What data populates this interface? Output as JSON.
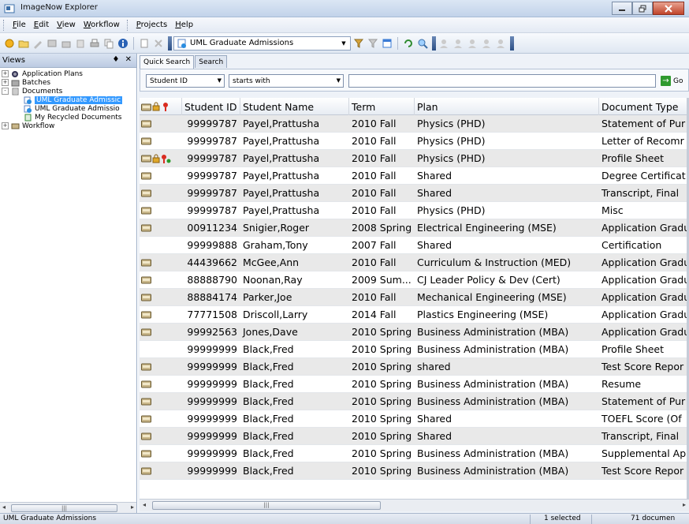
{
  "window": {
    "title": "ImageNow Explorer"
  },
  "menu": [
    {
      "label": "File",
      "u": "F",
      "rest": "ile"
    },
    {
      "label": "Edit",
      "u": "E",
      "rest": "dit"
    },
    {
      "label": "View",
      "u": "V",
      "rest": "iew"
    },
    {
      "label": "Workflow",
      "u": "W",
      "rest": "orkflow"
    },
    {
      "label": "Projects",
      "u": "P",
      "rest": "rojects"
    },
    {
      "label": "Help",
      "u": "H",
      "rest": "elp"
    }
  ],
  "toolbar": {
    "view_dropdown": "UML Graduate Admissions"
  },
  "views_panel": {
    "title": "Views",
    "tree": [
      {
        "label": "Application Plans",
        "expander": "+",
        "icon": "application-plans-icon",
        "indent": 0
      },
      {
        "label": "Batches",
        "expander": "+",
        "icon": "batches-icon",
        "indent": 0
      },
      {
        "label": "Documents",
        "expander": "-",
        "icon": "documents-icon",
        "indent": 0
      },
      {
        "label": "UML Graduate Admissic",
        "expander": "",
        "icon": "document-view-icon",
        "indent": 1,
        "selected": true
      },
      {
        "label": "UML Graduate Admissio",
        "expander": "",
        "icon": "document-view-icon",
        "indent": 1
      },
      {
        "label": "My Recycled Documents",
        "expander": "",
        "icon": "recycle-icon",
        "indent": 1
      },
      {
        "label": "Workflow",
        "expander": "+",
        "icon": "workflow-icon",
        "indent": 0
      }
    ]
  },
  "tabs": [
    {
      "label": "Quick Search",
      "active": true
    },
    {
      "label": "Search",
      "active": false
    }
  ],
  "search": {
    "field": "Student ID",
    "operator": "starts with",
    "value": "",
    "go_label": "Go"
  },
  "grid": {
    "columns": [
      "Student ID",
      "Student Name",
      "Term",
      "Plan",
      "Document Type"
    ],
    "rows": [
      {
        "icons": [
          "doc"
        ],
        "sid": "99999787",
        "name": "Payel,Prattusha",
        "term": "2010 Fall",
        "plan": "Physics (PHD)",
        "doc": "Statement of Pur"
      },
      {
        "icons": [
          "doc"
        ],
        "sid": "99999787",
        "name": "Payel,Prattusha",
        "term": "2010 Fall",
        "plan": "Physics (PHD)",
        "doc": "Letter of Recomr"
      },
      {
        "icons": [
          "doc",
          "lock",
          "flag"
        ],
        "sid": "99999787",
        "name": "Payel,Prattusha",
        "term": "2010 Fall",
        "plan": "Physics (PHD)",
        "doc": "Profile Sheet"
      },
      {
        "icons": [
          "doc"
        ],
        "sid": "99999787",
        "name": "Payel,Prattusha",
        "term": "2010 Fall",
        "plan": "Shared",
        "doc": "Degree Certificat"
      },
      {
        "icons": [
          "doc"
        ],
        "sid": "99999787",
        "name": "Payel,Prattusha",
        "term": "2010 Fall",
        "plan": "Shared",
        "doc": "Transcript, Final"
      },
      {
        "icons": [
          "doc"
        ],
        "sid": "99999787",
        "name": "Payel,Prattusha",
        "term": "2010 Fall",
        "plan": "Physics (PHD)",
        "doc": "Misc"
      },
      {
        "icons": [
          "doc"
        ],
        "sid": "00911234",
        "name": "Snigier,Roger",
        "term": "2008 Spring",
        "plan": "Electrical Engineering (MSE)",
        "doc": "Application Gradu"
      },
      {
        "icons": [],
        "sid": "99999888",
        "name": "Graham,Tony",
        "term": "2007 Fall",
        "plan": "Shared",
        "doc": "Certification"
      },
      {
        "icons": [
          "doc"
        ],
        "sid": "44439662",
        "name": "McGee,Ann",
        "term": "2010 Fall",
        "plan": "Curriculum & Instruction (MED)",
        "doc": "Application Gradu"
      },
      {
        "icons": [
          "doc"
        ],
        "sid": "88888790",
        "name": "Noonan,Ray",
        "term": "2009 Sum...",
        "plan": "CJ Leader Policy & Dev (Cert)",
        "doc": "Application Gradu"
      },
      {
        "icons": [
          "doc"
        ],
        "sid": "88884174",
        "name": "Parker,Joe",
        "term": "2010 Fall",
        "plan": "Mechanical Engineering (MSE)",
        "doc": "Application Gradu"
      },
      {
        "icons": [
          "doc"
        ],
        "sid": "77771508",
        "name": "Driscoll,Larry",
        "term": "2014 Fall",
        "plan": "Plastics Engineering (MSE)",
        "doc": "Application Gradu"
      },
      {
        "icons": [
          "doc"
        ],
        "sid": "99992563",
        "name": "Jones,Dave",
        "term": "2010 Spring",
        "plan": "Business Administration (MBA)",
        "doc": "Application Gradu"
      },
      {
        "icons": [],
        "sid": "99999999",
        "name": "Black,Fred",
        "term": "2010 Spring",
        "plan": "Business Administration (MBA)",
        "doc": "Profile Sheet"
      },
      {
        "icons": [
          "doc"
        ],
        "sid": "99999999",
        "name": "Black,Fred",
        "term": "2010 Spring",
        "plan": "shared",
        "doc": "Test Score Repor"
      },
      {
        "icons": [
          "doc"
        ],
        "sid": "99999999",
        "name": "Black,Fred",
        "term": "2010 Spring",
        "plan": "Business Administration (MBA)",
        "doc": "Resume"
      },
      {
        "icons": [
          "doc"
        ],
        "sid": "99999999",
        "name": "Black,Fred",
        "term": "2010 Spring",
        "plan": "Business Administration (MBA)",
        "doc": "Statement of Pur"
      },
      {
        "icons": [
          "doc"
        ],
        "sid": "99999999",
        "name": "Black,Fred",
        "term": "2010 Spring",
        "plan": "Shared",
        "doc": "TOEFL Score (Of"
      },
      {
        "icons": [
          "doc"
        ],
        "sid": "99999999",
        "name": "Black,Fred",
        "term": "2010 Spring",
        "plan": "Shared",
        "doc": "Transcript, Final"
      },
      {
        "icons": [
          "doc"
        ],
        "sid": "99999999",
        "name": "Black,Fred",
        "term": "2010 Spring",
        "plan": "Business Administration (MBA)",
        "doc": "Supplemental Ap"
      },
      {
        "icons": [
          "doc"
        ],
        "sid": "99999999",
        "name": "Black,Fred",
        "term": "2010 Spring",
        "plan": "Business Administration (MBA)",
        "doc": "Test Score Repor"
      }
    ]
  },
  "status": {
    "left": "UML Graduate Admissions",
    "selected": "1 selected",
    "count": "71 documen"
  },
  "colors": {
    "selection": "#3399ff",
    "alt_row": "#e9e9e9",
    "title_gradient_top": "#dbe6f4"
  }
}
